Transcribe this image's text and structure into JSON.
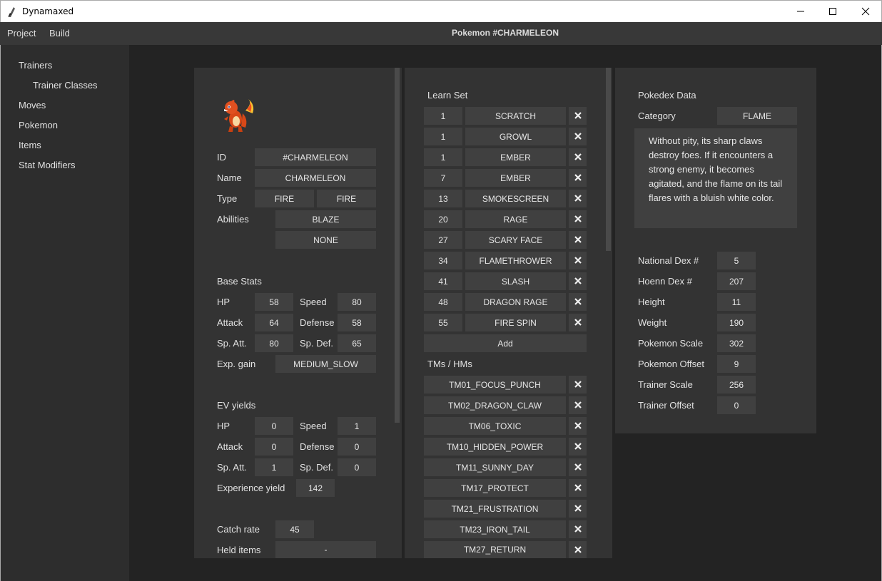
{
  "window": {
    "title": "Dynamaxed"
  },
  "menu": {
    "project": "Project",
    "build": "Build",
    "page_title": "Pokemon #CHARMELEON"
  },
  "sidebar": {
    "items": [
      {
        "label": "Trainers"
      },
      {
        "label": "Trainer Classes"
      },
      {
        "label": "Moves"
      },
      {
        "label": "Pokemon"
      },
      {
        "label": "Items"
      },
      {
        "label": "Stat Modifiers"
      }
    ]
  },
  "info": {
    "id_label": "ID",
    "id": "#CHARMELEON",
    "name_label": "Name",
    "name": "CHARMELEON",
    "type_label": "Type",
    "type1": "FIRE",
    "type2": "FIRE",
    "abilities_label": "Abilities",
    "ability1": "BLAZE",
    "ability2": "NONE"
  },
  "base_stats": {
    "heading": "Base Stats",
    "hp_label": "HP",
    "hp": "58",
    "speed_label": "Speed",
    "speed": "80",
    "attack_label": "Attack",
    "attack": "64",
    "defense_label": "Defense",
    "defense": "58",
    "spatt_label": "Sp. Att.",
    "spatt": "80",
    "spdef_label": "Sp. Def.",
    "spdef": "65",
    "expgain_label": "Exp. gain",
    "expgain": "MEDIUM_SLOW"
  },
  "ev_yields": {
    "heading": "EV yields",
    "hp_label": "HP",
    "hp": "0",
    "speed_label": "Speed",
    "speed": "1",
    "attack_label": "Attack",
    "attack": "0",
    "defense_label": "Defense",
    "defense": "0",
    "spatt_label": "Sp. Att.",
    "spatt": "1",
    "spdef_label": "Sp. Def.",
    "spdef": "0",
    "expyield_label": "Experience yield",
    "expyield": "142"
  },
  "misc": {
    "catch_label": "Catch rate",
    "catch": "45",
    "held_label": "Held items",
    "held": "-"
  },
  "learnset": {
    "heading": "Learn Set",
    "moves": [
      {
        "level": "1",
        "move": "SCRATCH"
      },
      {
        "level": "1",
        "move": "GROWL"
      },
      {
        "level": "1",
        "move": "EMBER"
      },
      {
        "level": "7",
        "move": "EMBER"
      },
      {
        "level": "13",
        "move": "SMOKESCREEN"
      },
      {
        "level": "20",
        "move": "RAGE"
      },
      {
        "level": "27",
        "move": "SCARY FACE"
      },
      {
        "level": "34",
        "move": "FLAMETHROWER"
      },
      {
        "level": "41",
        "move": "SLASH"
      },
      {
        "level": "48",
        "move": "DRAGON RAGE"
      },
      {
        "level": "55",
        "move": "FIRE SPIN"
      }
    ],
    "add_label": "Add"
  },
  "tms": {
    "heading": "TMs / HMs",
    "items": [
      "TM01_FOCUS_PUNCH",
      "TM02_DRAGON_CLAW",
      "TM06_TOXIC",
      "TM10_HIDDEN_POWER",
      "TM11_SUNNY_DAY",
      "TM17_PROTECT",
      "TM21_FRUSTRATION",
      "TM23_IRON_TAIL",
      "TM27_RETURN"
    ]
  },
  "pokedex": {
    "heading": "Pokedex Data",
    "category_label": "Category",
    "category": "FLAME",
    "description": "Without pity, its sharp claws destroy foes. If it encounters a strong enemy, it becomes agitated, and the flame on its tail flares with a bluish white color.",
    "national_label": "National Dex #",
    "national": "5",
    "hoenn_label": "Hoenn Dex #",
    "hoenn": "207",
    "height_label": "Height",
    "height": "11",
    "weight_label": "Weight",
    "weight": "190",
    "pscale_label": "Pokemon Scale",
    "pscale": "302",
    "poffset_label": "Pokemon Offset",
    "poffset": "9",
    "tscale_label": "Trainer Scale",
    "tscale": "256",
    "toffset_label": "Trainer Offset",
    "toffset": "0"
  },
  "icons": {
    "app": "quill-icon",
    "remove": "close-x-icon",
    "sprite": "charmeleon-sprite"
  }
}
